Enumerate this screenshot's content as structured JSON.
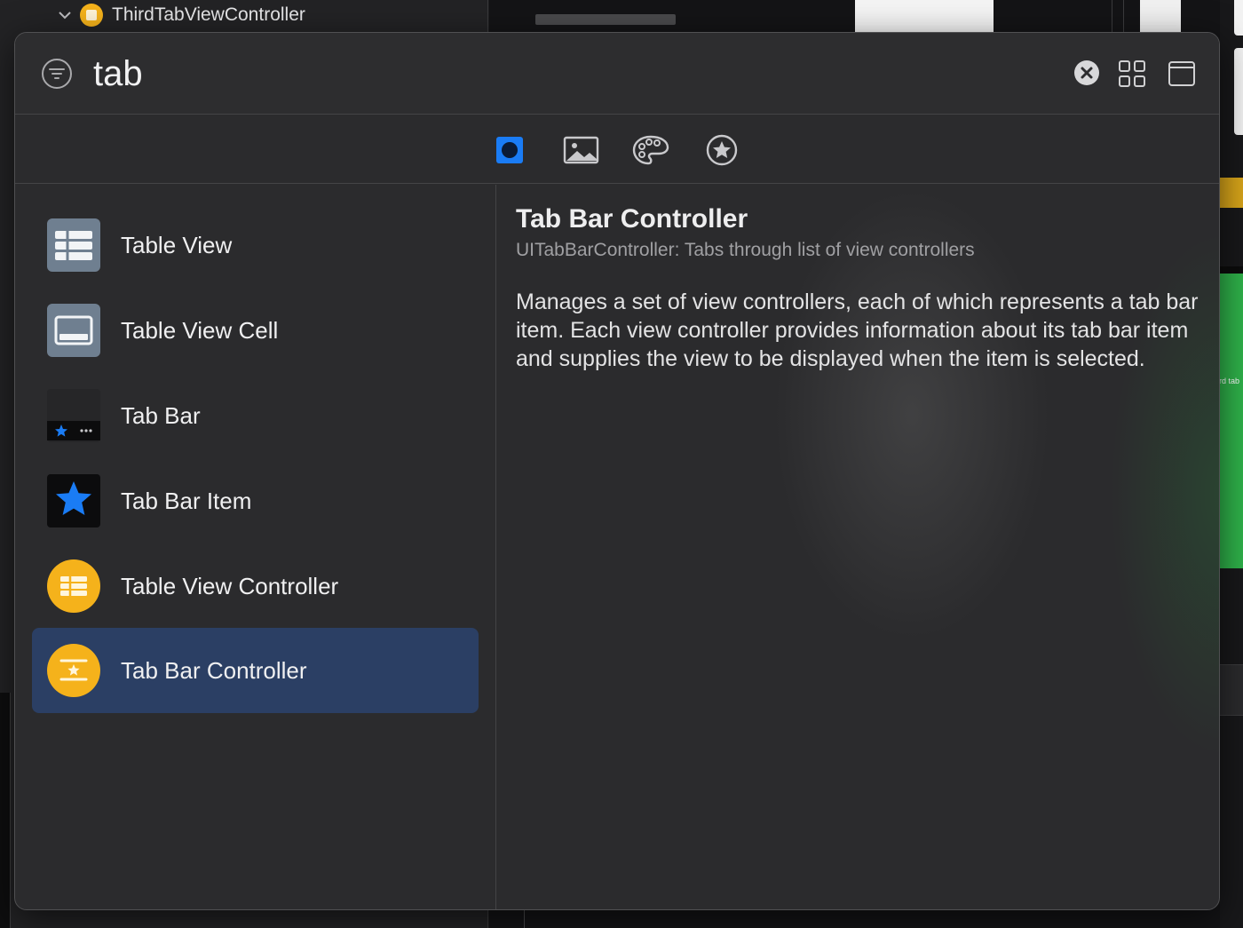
{
  "background": {
    "outline_item": "ThirdTabViewController",
    "canvas_snippet": "rd tab"
  },
  "search": {
    "value": "tab"
  },
  "toolbar_icons": {
    "filter": "filter-icon",
    "clear": "clear-icon",
    "grid": "grid-icon",
    "panel": "panel-icon"
  },
  "categories": [
    {
      "name": "objects",
      "icon": "square-circle-icon",
      "selected": true
    },
    {
      "name": "media",
      "icon": "photo-icon",
      "selected": false
    },
    {
      "name": "colors",
      "icon": "palette-icon",
      "selected": false
    },
    {
      "name": "snippets",
      "icon": "star-circle-icon",
      "selected": false
    }
  ],
  "items": [
    {
      "label": "Table View",
      "icon": "table-view-icon"
    },
    {
      "label": "Table View Cell",
      "icon": "table-view-cell-icon"
    },
    {
      "label": "Tab Bar",
      "icon": "tab-bar-icon"
    },
    {
      "label": "Tab Bar Item",
      "icon": "tab-bar-item-icon"
    },
    {
      "label": "Table View Controller",
      "icon": "table-view-controller-icon"
    },
    {
      "label": "Tab Bar Controller",
      "icon": "tab-bar-controller-icon",
      "selected": true
    }
  ],
  "detail": {
    "title": "Tab Bar Controller",
    "subtitle": "UITabBarController: Tabs through list of view controllers",
    "description": "Manages a set of view controllers, each of which represents a tab bar item. Each view controller provides information about its tab bar item and supplies the view to be displayed when the item is selected."
  },
  "colors": {
    "accent_blue": "#1a7cf5",
    "selection": "#2b3f64",
    "controller_yellow": "#f5b21b",
    "view_gray": "#6f7f90"
  }
}
